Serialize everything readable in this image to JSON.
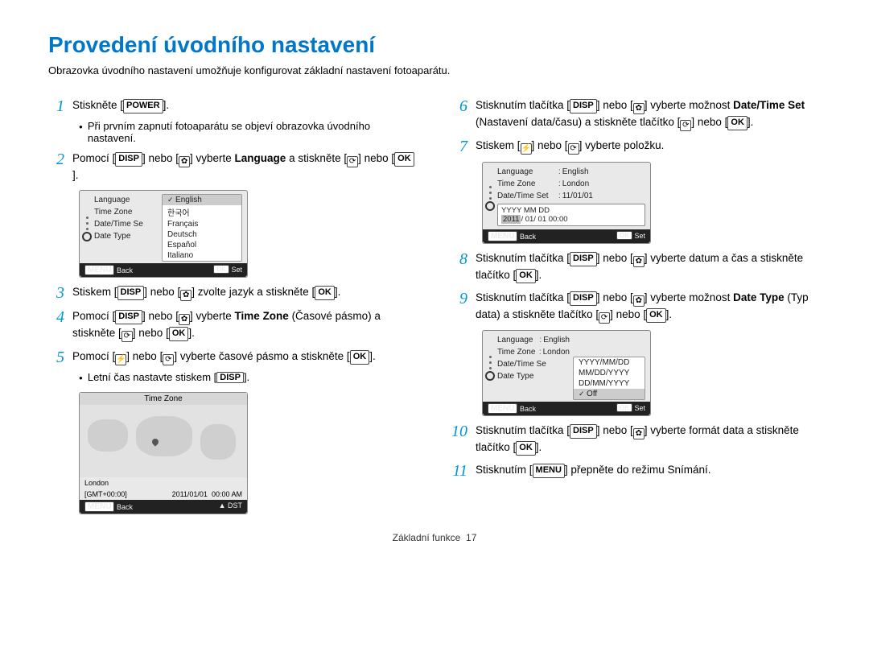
{
  "title": "Provedení úvodního nastavení",
  "intro": "Obrazovka úvodního nastavení umožňuje konfigurovat základní nastavení fotoaparátu.",
  "keys": {
    "power": "POWER",
    "disp": "DISP",
    "ok": "OK",
    "menu": "MENU"
  },
  "steps": {
    "s1": {
      "num": "1",
      "a": "Stiskněte [",
      "b": "]."
    },
    "s1_bullet": "Při prvním zapnutí fotoaparátu se objeví obrazovka úvodního nastavení.",
    "s2": {
      "num": "2",
      "a": "Pomocí [",
      "b": "] nebo [",
      "c": "] vyberte ",
      "d": "Language",
      "e": " a stiskněte [",
      "f": "] nebo [",
      "g": "]."
    },
    "s3": {
      "num": "3",
      "a": "Stiskem [",
      "b": "] nebo [",
      "c": "] zvolte jazyk a stiskněte [",
      "d": "]."
    },
    "s4": {
      "num": "4",
      "a": "Pomocí [",
      "b": "] nebo [",
      "c": "] vyberte ",
      "d": "Time Zone",
      "e": " (Časové pásmo) a stiskněte [",
      "f": "] nebo [",
      "g": "]."
    },
    "s5": {
      "num": "5",
      "a": "Pomocí [",
      "b": "] nebo [",
      "c": "] vyberte časové pásmo a stiskněte [",
      "d": "]."
    },
    "s5_bullet": "Letní čas nastavte stiskem [",
    "s5_bullet_end": "].",
    "s6": {
      "num": "6",
      "a": "Stisknutím tlačítka [",
      "b": "] nebo [",
      "c": "] vyberte možnost ",
      "d": "Date/Time Set",
      "e": " (Nastavení data/času) a stiskněte tlačítko [",
      "f": "] nebo [",
      "g": "]."
    },
    "s7": {
      "num": "7",
      "a": "Stiskem [",
      "b": "] nebo [",
      "c": "] vyberte položku."
    },
    "s8": {
      "num": "8",
      "a": "Stisknutím tlačítka [",
      "b": "] nebo [",
      "c": "] vyberte datum a čas a stiskněte tlačítko [",
      "d": "]."
    },
    "s9": {
      "num": "9",
      "a": "Stisknutím tlačítka [",
      "b": "] nebo [",
      "c": "] vyberte možnost ",
      "d": "Date Type",
      "e": " (Typ data) a stiskněte tlačítko [",
      "f": "] nebo [",
      "g": "]."
    },
    "s10": {
      "num": "10",
      "a": "Stisknutím tlačítka [",
      "b": "] nebo [",
      "c": "] vyberte formát data a stiskněte tlačítko [",
      "d": "]."
    },
    "s11": {
      "num": "11",
      "a": "Stisknutím [",
      "b": "] přepněte do režimu Snímání."
    }
  },
  "cam1": {
    "items": [
      "Language",
      "Time Zone",
      "Date/Time Se",
      "Date Type"
    ],
    "langs": [
      "English",
      "한국어",
      "Français",
      "Deutsch",
      "Español",
      "Italiano"
    ],
    "bar_back": "Back",
    "bar_set": "Set"
  },
  "tz": {
    "title": "Time Zone",
    "city": "London",
    "gmt": "[GMT+00:00]",
    "date": "2011/01/01",
    "time": "00:00 AM",
    "bar_back": "Back",
    "bar_dst": "DST"
  },
  "cam2": {
    "rows": [
      {
        "l": "Language",
        "r": "English"
      },
      {
        "l": "Time Zone",
        "r": "London"
      },
      {
        "l": "Date/Time Set",
        "r": "11/01/01"
      }
    ],
    "edit_label": "YYYY  MM  DD",
    "edit_value_a": "2011",
    "edit_value_b": "/ 01/ 01  00:00",
    "bar_back": "Back",
    "bar_set": "Set"
  },
  "cam3": {
    "rows": [
      {
        "l": "Language",
        "r": "English"
      },
      {
        "l": "Time Zone",
        "r": "London"
      },
      {
        "l": "Date/Time Se",
        "r": ""
      },
      {
        "l": "Date Type",
        "r": ""
      }
    ],
    "opts": [
      "YYYY/MM/DD",
      "MM/DD/YYYY",
      "DD/MM/YYYY",
      "Off"
    ],
    "bar_back": "Back",
    "bar_set": "Set"
  },
  "footer": {
    "label": "Základní funkce",
    "page": "17"
  }
}
